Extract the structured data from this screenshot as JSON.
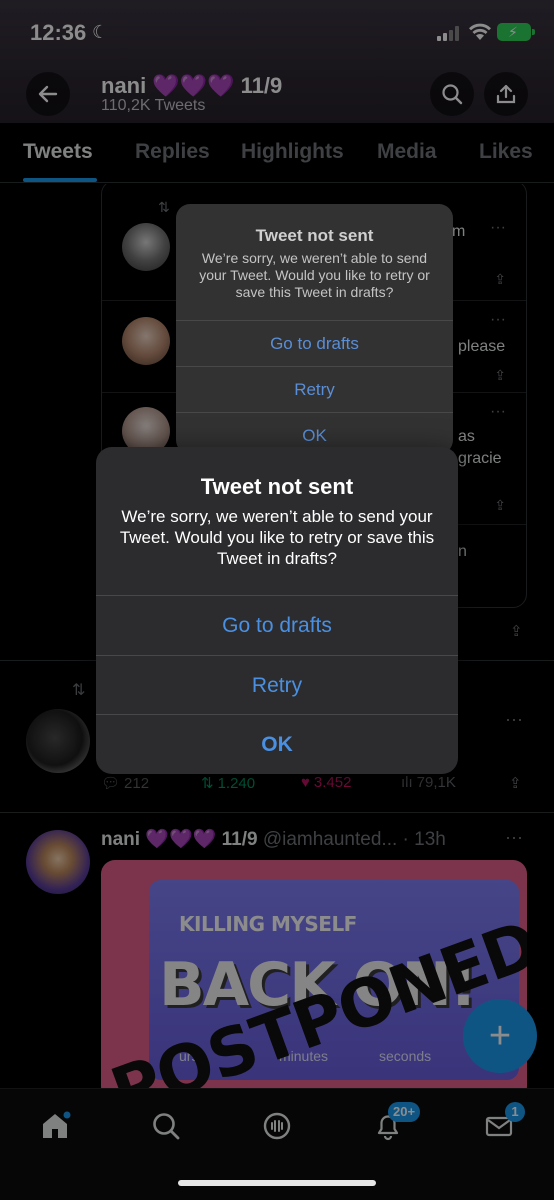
{
  "status_bar": {
    "time": "12:36"
  },
  "header": {
    "back_icon": "arrow-left-icon",
    "name": "nani",
    "name_suffix": "11/9",
    "tweet_count": "110,2K Tweets",
    "search_icon": "search-icon",
    "share_icon": "share-icon"
  },
  "tabs": [
    {
      "label": "Tweets",
      "active": true
    },
    {
      "label": "Replies",
      "active": false
    },
    {
      "label": "Highlights",
      "active": false
    },
    {
      "label": "Media",
      "active": false
    },
    {
      "label": "Likes",
      "active": false
    }
  ],
  "quote_rows": [
    {
      "text_fragment": "m"
    },
    {
      "text_fragment": "please"
    },
    {
      "text_fragment_1": "as",
      "text_fragment_2": "gracie"
    },
    {
      "text_fragment": "n"
    }
  ],
  "tweet1": {
    "replies": "212",
    "retweets": "1.240",
    "likes": "3.452",
    "views": "79,1K"
  },
  "tweet2": {
    "name": "nani",
    "date": "11/9",
    "handle_time": "@iamhaunted... · 13h",
    "media": {
      "top_text": "KILLING MYSELF",
      "big_text": "BACK ON!",
      "stamp": "POSTPONED",
      "label_hours": "urs",
      "label_minutes": "minutes",
      "label_seconds": "seconds"
    }
  },
  "dialog_back": {
    "title": "Tweet not sent",
    "message": "We’re sorry, we weren’t able to send your Tweet. Would you like to retry or save this Tweet in drafts?",
    "go_to_drafts": "Go to drafts",
    "retry": "Retry",
    "ok": "OK"
  },
  "dialog_front": {
    "title": "Tweet not sent",
    "message": "We’re sorry, we weren’t able to send your Tweet. Would you like to retry or save this Tweet in drafts?",
    "go_to_drafts": "Go to drafts",
    "retry": "Retry",
    "ok": "OK"
  },
  "bottom_nav": {
    "notifications_badge": "20+",
    "messages_badge": "1"
  },
  "colors": {
    "accent": "#1d9bf0",
    "retweet": "#00ba7c",
    "like": "#f91880",
    "dialog_button": "#4a90e2"
  }
}
